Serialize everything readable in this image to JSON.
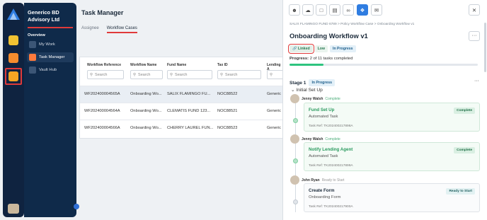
{
  "rail": {
    "apps": [
      "app-1",
      "app-2",
      "app-3"
    ],
    "accent": "#e03a3a"
  },
  "sidebar": {
    "org": "Generico BD Advisory Ltd",
    "section": "Overview",
    "items": [
      {
        "label": "My Work"
      },
      {
        "label": "Task Manager",
        "active": true
      },
      {
        "label": "Vault Hub"
      }
    ]
  },
  "main": {
    "title": "Task Manager",
    "tabs": [
      {
        "label": "Assignee"
      },
      {
        "label": "Workflow Cases",
        "active": true
      }
    ],
    "columns": [
      "Workflow Reference",
      "Workflow Name",
      "Fund Name",
      "Tax ID",
      "Lending A"
    ],
    "search_placeholder": "Search",
    "rows": [
      {
        "ref": "WF202400004565A",
        "name": "Onboarding Wo...",
        "fund": "SALIX FLAMINGO FU...",
        "tax": "NOC88522",
        "lend": "Generic"
      },
      {
        "ref": "WF202400004564A",
        "name": "Onboarding Wo...",
        "fund": "CLEMATIS FUND 123...",
        "tax": "NOC88521",
        "lend": "Generic"
      },
      {
        "ref": "WF202400004566A",
        "name": "Onboarding Wo...",
        "fund": "CHERRY LAUREL FUN...",
        "tax": "NOC88523",
        "lend": "Generic"
      }
    ]
  },
  "panel": {
    "toolbar": [
      "user-icon",
      "cloud-icon",
      "folder-icon",
      "clipboard-icon",
      "link-icon",
      "workflow-icon",
      "mail-icon"
    ],
    "breadcrumb": "SALIX FLAMINGO FUND 6789  >  Policy Workflow Case  >  Onboarding Workflow v1",
    "title": "Onboarding Workflow v1",
    "badges": {
      "linked": "Linked",
      "priority": "Low",
      "status": "In Progress"
    },
    "progress": {
      "label": "Progress:",
      "text": "2 of 11 tasks completed",
      "fraction": 0.18
    },
    "stage": {
      "label": "Stage 1",
      "status": "In Progress",
      "group": "Initial Set Up"
    },
    "tasks": [
      {
        "person": "Jenny Walsh",
        "state": "Complete",
        "title": "Fund Set Up",
        "subtitle": "Automated Task",
        "ref": "Task Ref: TK202400217898A",
        "badge": "Complete"
      },
      {
        "person": "Jenny Walsh",
        "state": "Complete",
        "title": "Notify Lending Agent",
        "subtitle": "Automated Task",
        "ref": "Task Ref: TK202400217899A",
        "badge": "Complete"
      },
      {
        "person": "John Ryan",
        "state": "Ready to Start",
        "title": "Create Form",
        "subtitle": "Onboarding Form",
        "ref": "Task Ref: TK202400217900A",
        "badge": "Ready to Start"
      }
    ],
    "colors": {
      "primary": "#2f7de1",
      "success": "#2ec47f"
    }
  }
}
